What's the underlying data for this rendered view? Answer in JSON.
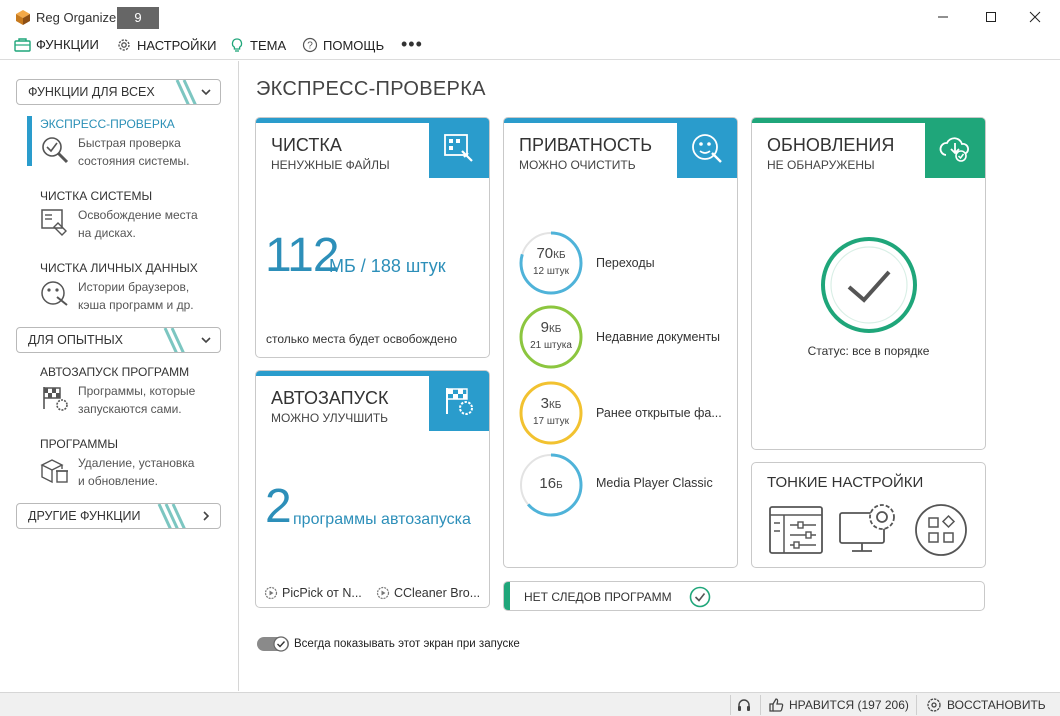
{
  "window": {
    "app_name": "Reg Organizer",
    "version": "9"
  },
  "menu": {
    "functions": "ФУНКЦИИ",
    "settings": "НАСТРОЙКИ",
    "theme": "ТЕМА",
    "help": "ПОМОЩЬ",
    "more": "•••"
  },
  "sidebar": {
    "for_all": "ФУНКЦИИ ДЛЯ ВСЕХ",
    "for_experienced": "ДЛЯ ОПЫТНЫХ",
    "other": "ДРУГИЕ ФУНКЦИИ",
    "express": {
      "title": "ЭКСПРЕСС-ПРОВЕРКА",
      "desc1": "Быстрая проверка",
      "desc2": "состояния системы."
    },
    "system_clean": {
      "title": "ЧИСТКА СИСТЕМЫ",
      "desc1": "Освобождение места",
      "desc2": "на дисках."
    },
    "private_clean": {
      "title": "ЧИСТКА ЛИЧНЫХ ДАННЫХ",
      "desc1": "Истории браузеров,",
      "desc2": "кэша программ и др."
    },
    "autostart": {
      "title": "АВТОЗАПУСК ПРОГРАММ",
      "desc1": "Программы, которые",
      "desc2": "запускаются сами."
    },
    "programs": {
      "title": "ПРОГРАММЫ",
      "desc1": "Удаление, установка",
      "desc2": "и обновление."
    }
  },
  "main": {
    "title": "ЭКСПРЕСС-ПРОВЕРКА",
    "cleaning": {
      "title": "ЧИСТКА",
      "subtitle": "НЕНУЖНЫЕ ФАЙЛЫ",
      "size_value": "112",
      "size_unit": "МБ / 188 штук",
      "note": "столько места будет освобождено"
    },
    "autorun": {
      "title": "АВТОЗАПУСК",
      "subtitle": "МОЖНО УЛУЧШИТЬ",
      "count": "2",
      "count_label": "программы автозапуска",
      "item1": "PicPick от N...",
      "item2": "CCleaner Bro..."
    },
    "privacy": {
      "title": "ПРИВАТНОСТЬ",
      "subtitle": "МОЖНО ОЧИСТИТЬ",
      "items": [
        {
          "value": "70",
          "unit": "КБ",
          "count": "12 штук",
          "label": "Переходы",
          "color": "#4fb3d9"
        },
        {
          "value": "9",
          "unit": "КБ",
          "count": "21 штука",
          "label": "Недавние документы",
          "color": "#8cc63f"
        },
        {
          "value": "3",
          "unit": "КБ",
          "count": "17 штук",
          "label": "Ранее открытые фа...",
          "color": "#f2c230"
        },
        {
          "value": "16",
          "unit": "Б",
          "count": "",
          "label": "Media Player Classic",
          "color": "#4fb3d9"
        }
      ]
    },
    "updates": {
      "title": "ОБНОВЛЕНИЯ",
      "subtitle": "НЕ ОБНАРУЖЕНЫ",
      "status": "Статус: все в порядке"
    },
    "tweaks": {
      "title": "ТОНКИЕ НАСТРОЙКИ"
    },
    "no_traces": "НЕТ СЛЕДОВ ПРОГРАММ",
    "show_on_start": "Всегда показывать этот экран при запуске"
  },
  "statusbar": {
    "likes": "НРАВИТСЯ (197 206)",
    "restore": "ВОССТАНОВИТЬ"
  },
  "colors": {
    "accent_blue": "#2a9ccc",
    "accent_green": "#1fa67a",
    "text_blue": "#2d8fb9"
  }
}
